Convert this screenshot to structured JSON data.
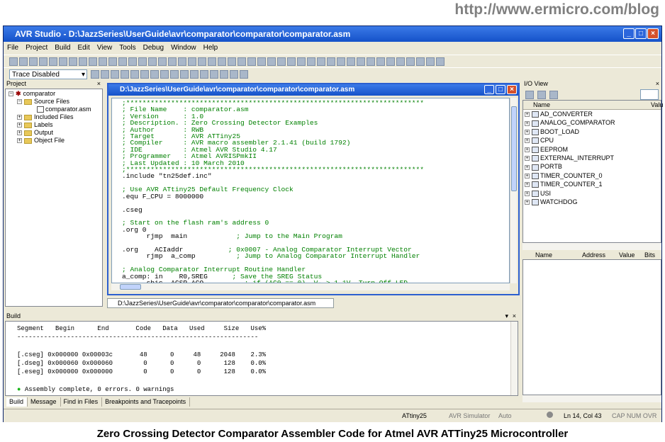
{
  "watermark_url": "http://www.ermicro.com/blog",
  "window": {
    "title": "AVR Studio - D:\\JazzSeries\\UserGuide\\avr\\comparator\\comparator\\comparator.asm"
  },
  "menu": [
    "File",
    "Project",
    "Build",
    "Edit",
    "View",
    "Tools",
    "Debug",
    "Window",
    "Help"
  ],
  "trace_dropdown": "Trace Disabled",
  "project_panel": {
    "title": "Project",
    "root": "comparator",
    "source_files": "Source Files",
    "file": "comparator.asm",
    "included_files": "Included Files",
    "labels": "Labels",
    "output": "Output",
    "object_file": "Object File"
  },
  "editor": {
    "title": "D:\\JazzSeries\\UserGuide\\avr\\comparator\\comparator\\comparator.asm",
    "tab_label": "D:\\JazzSeries\\UserGuide\\avr\\comparator\\comparator\\comparator.asm",
    "lines": [
      {
        "c": true,
        "t": ";*************************************************************************"
      },
      {
        "c": true,
        "t": "; File Name    : comparator.asm"
      },
      {
        "c": true,
        "t": "; Version      : 1.0"
      },
      {
        "c": true,
        "t": "; Description. : Zero Crossing Detector Examples"
      },
      {
        "c": true,
        "t": "; Author       : RWB"
      },
      {
        "c": true,
        "t": "; Target       : AVR ATTiny25"
      },
      {
        "c": true,
        "t": "; Compiler     : AVR macro assembler 2.1.41 (build 1792)"
      },
      {
        "c": true,
        "t": "; IDE          : Atmel AVR Studio 4.17"
      },
      {
        "c": true,
        "t": "; Programmer   : Atmel AVRISPmkII"
      },
      {
        "c": true,
        "t": "; Last Updated : 10 March 2010"
      },
      {
        "c": true,
        "t": ";*************************************************************************"
      },
      {
        "c": false,
        "t": ".include \"tn25def.inc\""
      },
      {
        "c": false,
        "t": ""
      },
      {
        "c": true,
        "t": "; Use AVR ATtiny25 Default Frequency Clock"
      },
      {
        "c": false,
        "t": ".equ F_CPU = 8000000"
      },
      {
        "c": false,
        "t": ""
      },
      {
        "c": false,
        "t": ".cseg"
      },
      {
        "c": false,
        "t": ""
      },
      {
        "c": true,
        "t": "; Start on the flash ram's address 0"
      },
      {
        "c": false,
        "t": ".org 0"
      },
      {
        "c": false,
        "t": "      rjmp  main",
        "cm": "            ; Jump to the Main Program"
      },
      {
        "c": false,
        "t": ""
      },
      {
        "c": false,
        "t": ".org    ACIaddr",
        "cm": "           ; 0x0007 - Analog Comparator Interrupt Vector"
      },
      {
        "c": false,
        "t": "      rjmp  a_comp",
        "cm": "          ; Jump to Analog Comparator Interrupt Handler"
      },
      {
        "c": false,
        "t": ""
      },
      {
        "c": true,
        "t": "; Analog Comparator Interrupt Routine Handler"
      },
      {
        "c": false,
        "t": "a_comp: in    R0,SREG",
        "cm": "      ; Save the SREG Status"
      },
      {
        "c": false,
        "t": "      sbic  ACSR,ACO",
        "cm": "          ; if (AC0 == 0), V- > 1.1V, Turn Off LED"
      }
    ]
  },
  "build": {
    "title": "Build",
    "header": "Segment   Begin      End       Code   Data   Used     Size   Use%",
    "separator": "---------------------------------------------------------------",
    "rows": [
      "[.cseg] 0x000000 0x00003c       48      0     48     2048    2.3%",
      "[.dseg] 0x000060 0x000060        0      0      0      128    0.0%",
      "[.eseg] 0x000000 0x000000        0      0      0      128    0.0%"
    ],
    "result": "Assembly complete, 0 errors. 0 warnings",
    "tabs": [
      "Build",
      "Message",
      "Find in Files",
      "Breakpoints and Tracepoints"
    ]
  },
  "io_view": {
    "title": "I/O View",
    "col_name": "Name",
    "col_value": "Valu",
    "items": [
      "AD_CONVERTER",
      "ANALOG_COMPARATOR",
      "BOOT_LOAD",
      "CPU",
      "EEPROM",
      "EXTERNAL_INTERRUPT",
      "PORTB",
      "TIMER_COUNTER_0",
      "TIMER_COUNTER_1",
      "USI",
      "WATCHDOG"
    ],
    "grid_cols": [
      "Name",
      "Address",
      "Value",
      "Bits"
    ]
  },
  "statusbar": {
    "device": "ATtiny25",
    "platform": "AVR Simulator",
    "mode": "Auto",
    "position": "Ln 14, Col 43",
    "keys": "CAP  NUM  OVR"
  },
  "caption": "Zero Crossing Detector Comparator Assembler Code for Atmel AVR ATTiny25 Microcontroller"
}
